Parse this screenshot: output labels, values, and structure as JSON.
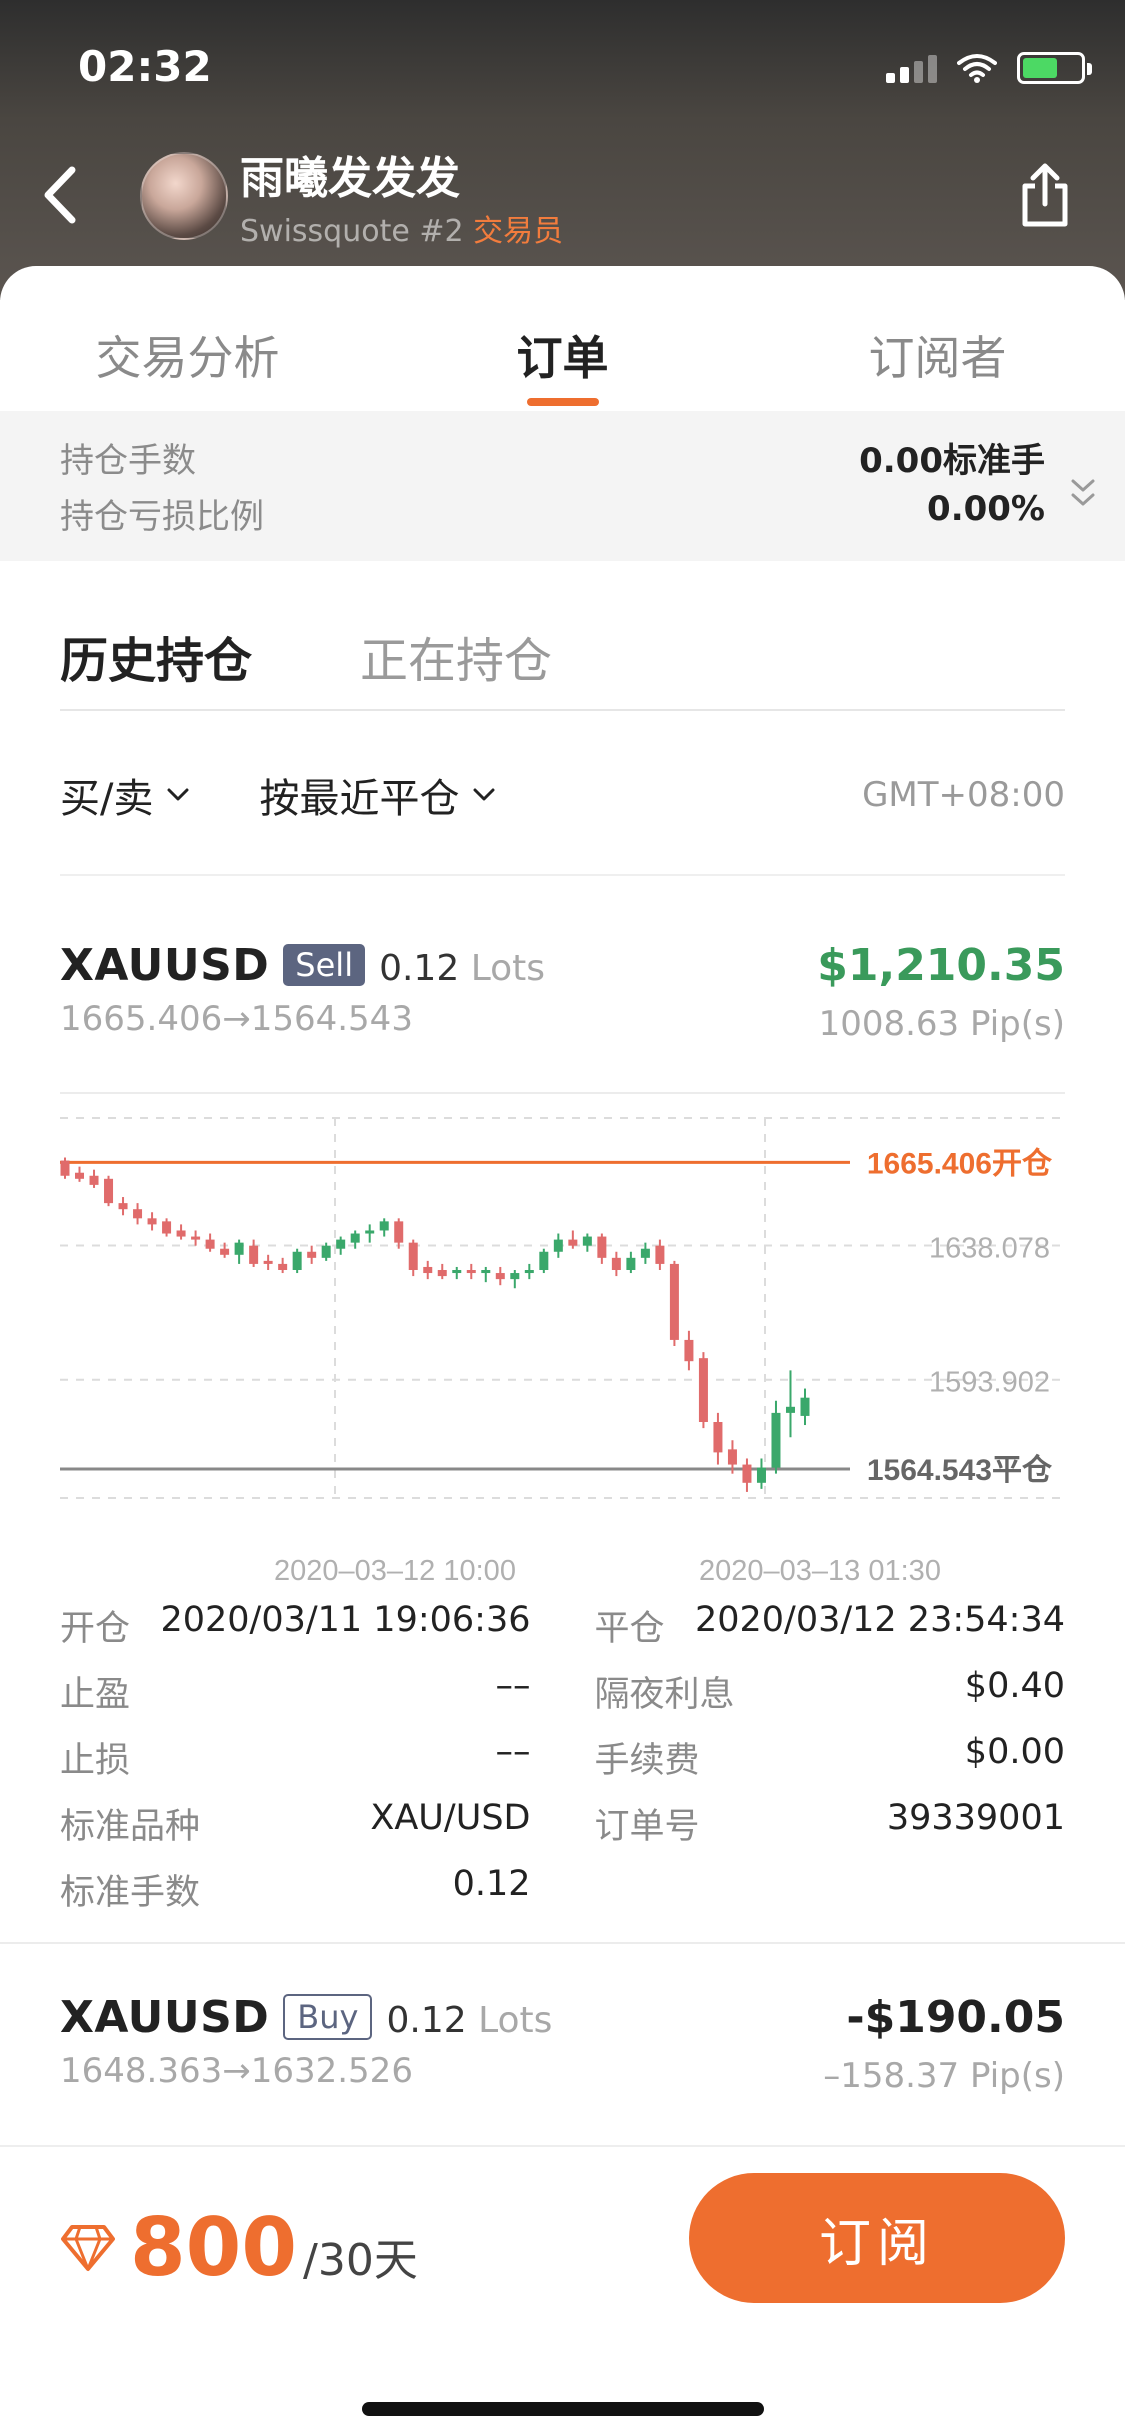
{
  "status_bar": {
    "time": "02:32"
  },
  "header": {
    "trader_name": "雨曦发发发",
    "broker": "Swissquote #2",
    "role": "交易员"
  },
  "tabs": [
    {
      "label": "交易分析",
      "active": false
    },
    {
      "label": "订单",
      "active": true
    },
    {
      "label": "订阅者",
      "active": false
    }
  ],
  "summary": {
    "position_lots_label": "持仓手数",
    "position_lots_value": "0.00标准手",
    "loss_ratio_label": "持仓亏损比例",
    "loss_ratio_value": "0.00%"
  },
  "subtabs": [
    {
      "label": "历史持仓",
      "active": true
    },
    {
      "label": "正在持仓",
      "active": false
    }
  ],
  "filters": {
    "side_label": "买/卖",
    "sort_label": "按最近平仓",
    "timezone": "GMT+08:00"
  },
  "orders": [
    {
      "symbol": "XAUUSD",
      "side": "Sell",
      "lots": "0.12",
      "lots_unit": "Lots",
      "route": "1665.406→1564.543",
      "pl": "$1,210.35",
      "pips": "1008.63 Pip(s)"
    },
    {
      "symbol": "XAUUSD",
      "side": "Buy",
      "lots": "0.12",
      "lots_unit": "Lots",
      "route": "1648.363→1632.526",
      "pl": "-$190.05",
      "pips": "–158.37 Pip(s)"
    }
  ],
  "chart_data": {
    "type": "candlestick",
    "y_ticks": [
      "1638.078",
      "1593.902"
    ],
    "x_ticks": [
      "2020–03–12 10:00",
      "2020–03–13 01:30"
    ],
    "open_label": "1665.406开仓",
    "close_label": "1564.543平仓",
    "open_price": 1665.406,
    "close_price": 1564.543,
    "ylim": [
      1555,
      1680
    ],
    "colors": {
      "up": "#3aa86b",
      "down": "#e06b6b",
      "open_line": "#ee6e2f",
      "close_line": "#888888"
    },
    "candles": [
      {
        "o": 1666,
        "h": 1667,
        "l": 1660,
        "c": 1661
      },
      {
        "o": 1662,
        "h": 1664,
        "l": 1659,
        "c": 1660
      },
      {
        "o": 1661,
        "h": 1663,
        "l": 1657,
        "c": 1658
      },
      {
        "o": 1660,
        "h": 1661,
        "l": 1651,
        "c": 1652
      },
      {
        "o": 1652,
        "h": 1654,
        "l": 1648,
        "c": 1650
      },
      {
        "o": 1650,
        "h": 1652,
        "l": 1645,
        "c": 1647
      },
      {
        "o": 1647,
        "h": 1649,
        "l": 1643,
        "c": 1645
      },
      {
        "o": 1646,
        "h": 1647,
        "l": 1641,
        "c": 1642
      },
      {
        "o": 1643,
        "h": 1645,
        "l": 1640,
        "c": 1641
      },
      {
        "o": 1641,
        "h": 1643,
        "l": 1638,
        "c": 1640
      },
      {
        "o": 1640,
        "h": 1642,
        "l": 1636,
        "c": 1637
      },
      {
        "o": 1637,
        "h": 1639,
        "l": 1634,
        "c": 1635
      },
      {
        "o": 1635,
        "h": 1640,
        "l": 1632,
        "c": 1639
      },
      {
        "o": 1638,
        "h": 1640,
        "l": 1631,
        "c": 1632
      },
      {
        "o": 1633,
        "h": 1635,
        "l": 1630,
        "c": 1632
      },
      {
        "o": 1632,
        "h": 1634,
        "l": 1629,
        "c": 1630
      },
      {
        "o": 1630,
        "h": 1637,
        "l": 1629,
        "c": 1636
      },
      {
        "o": 1636,
        "h": 1638,
        "l": 1632,
        "c": 1634
      },
      {
        "o": 1634,
        "h": 1639,
        "l": 1633,
        "c": 1638
      },
      {
        "o": 1637,
        "h": 1641,
        "l": 1635,
        "c": 1640
      },
      {
        "o": 1639,
        "h": 1643,
        "l": 1637,
        "c": 1642
      },
      {
        "o": 1642,
        "h": 1645,
        "l": 1639,
        "c": 1643
      },
      {
        "o": 1643,
        "h": 1647,
        "l": 1641,
        "c": 1646
      },
      {
        "o": 1646,
        "h": 1647,
        "l": 1637,
        "c": 1639
      },
      {
        "o": 1639,
        "h": 1640,
        "l": 1628,
        "c": 1630
      },
      {
        "o": 1631,
        "h": 1633,
        "l": 1627,
        "c": 1629
      },
      {
        "o": 1630,
        "h": 1632,
        "l": 1627,
        "c": 1628
      },
      {
        "o": 1629,
        "h": 1631,
        "l": 1627,
        "c": 1630
      },
      {
        "o": 1630,
        "h": 1632,
        "l": 1627,
        "c": 1629
      },
      {
        "o": 1629,
        "h": 1631,
        "l": 1626,
        "c": 1630
      },
      {
        "o": 1629,
        "h": 1631,
        "l": 1625,
        "c": 1627
      },
      {
        "o": 1627,
        "h": 1630,
        "l": 1624,
        "c": 1629
      },
      {
        "o": 1629,
        "h": 1632,
        "l": 1627,
        "c": 1630
      },
      {
        "o": 1630,
        "h": 1637,
        "l": 1629,
        "c": 1636
      },
      {
        "o": 1636,
        "h": 1642,
        "l": 1634,
        "c": 1640
      },
      {
        "o": 1640,
        "h": 1643,
        "l": 1637,
        "c": 1638
      },
      {
        "o": 1638,
        "h": 1642,
        "l": 1636,
        "c": 1641
      },
      {
        "o": 1641,
        "h": 1642,
        "l": 1632,
        "c": 1634
      },
      {
        "o": 1634,
        "h": 1636,
        "l": 1628,
        "c": 1630
      },
      {
        "o": 1630,
        "h": 1636,
        "l": 1629,
        "c": 1634
      },
      {
        "o": 1634,
        "h": 1639,
        "l": 1632,
        "c": 1637
      },
      {
        "o": 1638,
        "h": 1640,
        "l": 1630,
        "c": 1632
      },
      {
        "o": 1632,
        "h": 1633,
        "l": 1605,
        "c": 1607
      },
      {
        "o": 1607,
        "h": 1610,
        "l": 1597,
        "c": 1600
      },
      {
        "o": 1601,
        "h": 1603,
        "l": 1578,
        "c": 1580
      },
      {
        "o": 1580,
        "h": 1583,
        "l": 1566,
        "c": 1570
      },
      {
        "o": 1571,
        "h": 1574,
        "l": 1563,
        "c": 1566
      },
      {
        "o": 1566,
        "h": 1568,
        "l": 1557,
        "c": 1560
      },
      {
        "o": 1560,
        "h": 1568,
        "l": 1558,
        "c": 1565
      },
      {
        "o": 1565,
        "h": 1587,
        "l": 1563,
        "c": 1583
      },
      {
        "o": 1583,
        "h": 1597,
        "l": 1575,
        "c": 1585
      },
      {
        "o": 1582,
        "h": 1591,
        "l": 1579,
        "c": 1588
      }
    ]
  },
  "details": [
    {
      "left_key": "开仓",
      "left_val": "2020/03/11 19:06:36",
      "right_key": "平仓",
      "right_val": "2020/03/12 23:54:34"
    },
    {
      "left_key": "止盈",
      "left_val": "––",
      "right_key": "隔夜利息",
      "right_val": "$0.40"
    },
    {
      "left_key": "止损",
      "left_val": "––",
      "right_key": "手续费",
      "right_val": "$0.00"
    },
    {
      "left_key": "标准品种",
      "left_val": "XAU/USD",
      "right_key": "订单号",
      "right_val": "39339001"
    },
    {
      "left_key": "标准手数",
      "left_val": "0.12",
      "right_key": "",
      "right_val": ""
    }
  ],
  "bottom": {
    "price": "800",
    "period": "/30天",
    "subscribe_label": "订阅"
  }
}
